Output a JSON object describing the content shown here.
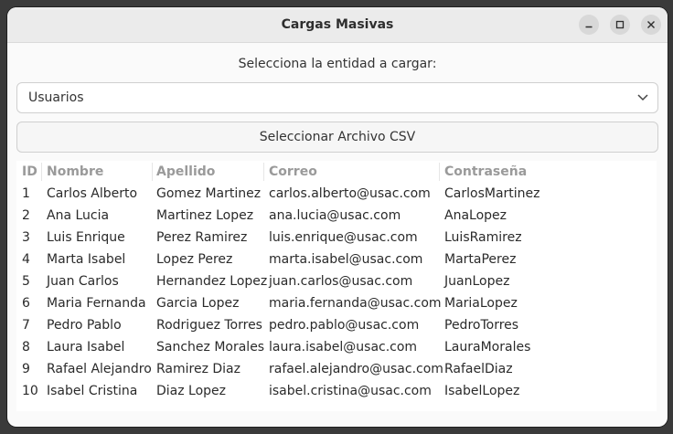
{
  "window": {
    "title": "Cargas Masivas",
    "controls": [
      "minimize-icon",
      "maximize-icon",
      "close-icon"
    ]
  },
  "prompt": "Selecciona la entidad a cargar:",
  "entity_select": {
    "value": "Usuarios"
  },
  "csv_button": {
    "label": "Seleccionar Archivo CSV"
  },
  "table": {
    "headers": [
      "ID",
      "Nombre",
      "Apellido",
      "Correo",
      "Contraseña"
    ],
    "rows": [
      [
        "1",
        "Carlos Alberto",
        "Gomez Martinez",
        "carlos.alberto@usac.com",
        "CarlosMartinez"
      ],
      [
        "2",
        "Ana Lucia",
        "Martinez Lopez",
        "ana.lucia@usac.com",
        "AnaLopez"
      ],
      [
        "3",
        "Luis Enrique",
        "Perez Ramirez",
        "luis.enrique@usac.com",
        "LuisRamirez"
      ],
      [
        "4",
        "Marta Isabel",
        "Lopez Perez",
        "marta.isabel@usac.com",
        "MartaPerez"
      ],
      [
        "5",
        "Juan Carlos",
        "Hernandez Lopez",
        "juan.carlos@usac.com",
        "JuanLopez"
      ],
      [
        "6",
        "Maria Fernanda",
        "Garcia Lopez",
        "maria.fernanda@usac.com",
        "MariaLopez"
      ],
      [
        "7",
        "Pedro Pablo",
        "Rodriguez Torres",
        "pedro.pablo@usac.com",
        "PedroTorres"
      ],
      [
        "8",
        "Laura Isabel",
        "Sanchez Morales",
        "laura.isabel@usac.com",
        "LauraMorales"
      ],
      [
        "9",
        "Rafael Alejandro",
        "Ramirez Diaz",
        "rafael.alejandro@usac.com",
        "RafaelDiaz"
      ],
      [
        "10",
        "Isabel Cristina",
        "Diaz Lopez",
        "isabel.cristina@usac.com",
        "IsabelLopez"
      ]
    ]
  }
}
